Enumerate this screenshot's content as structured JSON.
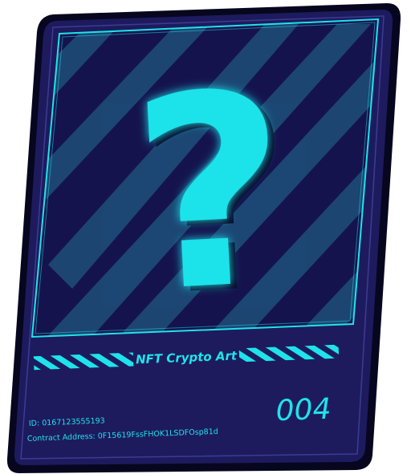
{
  "card": {
    "title": "NFT Crypto Art",
    "number": "004",
    "id_line": "ID: 0167123555193",
    "contract_line": "Contract Address: 0F15619FssFHOK1LSDFOsp81d",
    "symbol": "?"
  },
  "colors": {
    "frame": "#1d1b5e",
    "frame_edge": "#07061f",
    "panel": "#15134d",
    "stripe": "#1e4f7a",
    "accent": "#1fe3ea",
    "glow": "#0f8f98"
  },
  "icons": {
    "hero": "question-mark-icon"
  }
}
